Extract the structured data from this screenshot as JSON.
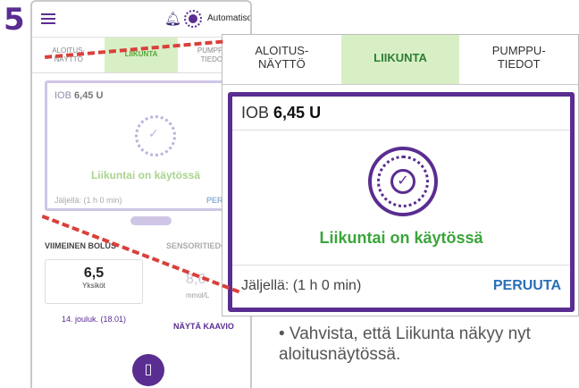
{
  "step": "5",
  "phone": {
    "status": {
      "mode_label": "Automatisoitu",
      "icons": [
        "menu-icon",
        "bell-icon",
        "automated-mode-icon"
      ]
    },
    "tabs": [
      "ALOITUS-\nNÄYTTÖ",
      "LIIKUNTA",
      "PUMPPU-\nTIEDOT"
    ],
    "card": {
      "iob_label": "IOB",
      "iob_value": "6,45 U",
      "activity_text": "Liikuntai on käytössä",
      "remaining": "Jäljellä: (1 h 0 min)",
      "cancel": "PERUUTA"
    },
    "bolus": {
      "title": "VIIMEINEN BOLUS",
      "value": "6,5",
      "unit": "Yksiköt",
      "date": "14. jouluk. (18.01)"
    },
    "sensor": {
      "title": "SENSORITIEDOT",
      "value": "8,6",
      "unit": "mmol/L",
      "link": "NÄYTÄ KAAVIO"
    },
    "bolus_button_icon": "bolus-icon"
  },
  "zoom": {
    "tabs": [
      "ALOITUS-\nNÄYTTÖ",
      "LIIKUNTA",
      "PUMPPU-\nTIEDOT"
    ],
    "iob_label": "IOB",
    "iob_value": "6,45 U",
    "activity_text": "Liikuntai on käytössä",
    "remaining": "Jäljellä: (1 h 0 min)",
    "cancel": "PERUUTA"
  },
  "instruction": "• Vahvista, että Liikunta näkyy nyt aloitusnäytössä.",
  "colors": {
    "brand_purple": "#5a2d91",
    "active_green": "#3aa53a",
    "tab_green_bg": "#d8efc6",
    "callout_red": "#d9403a",
    "link_blue": "#2a6fb8"
  }
}
